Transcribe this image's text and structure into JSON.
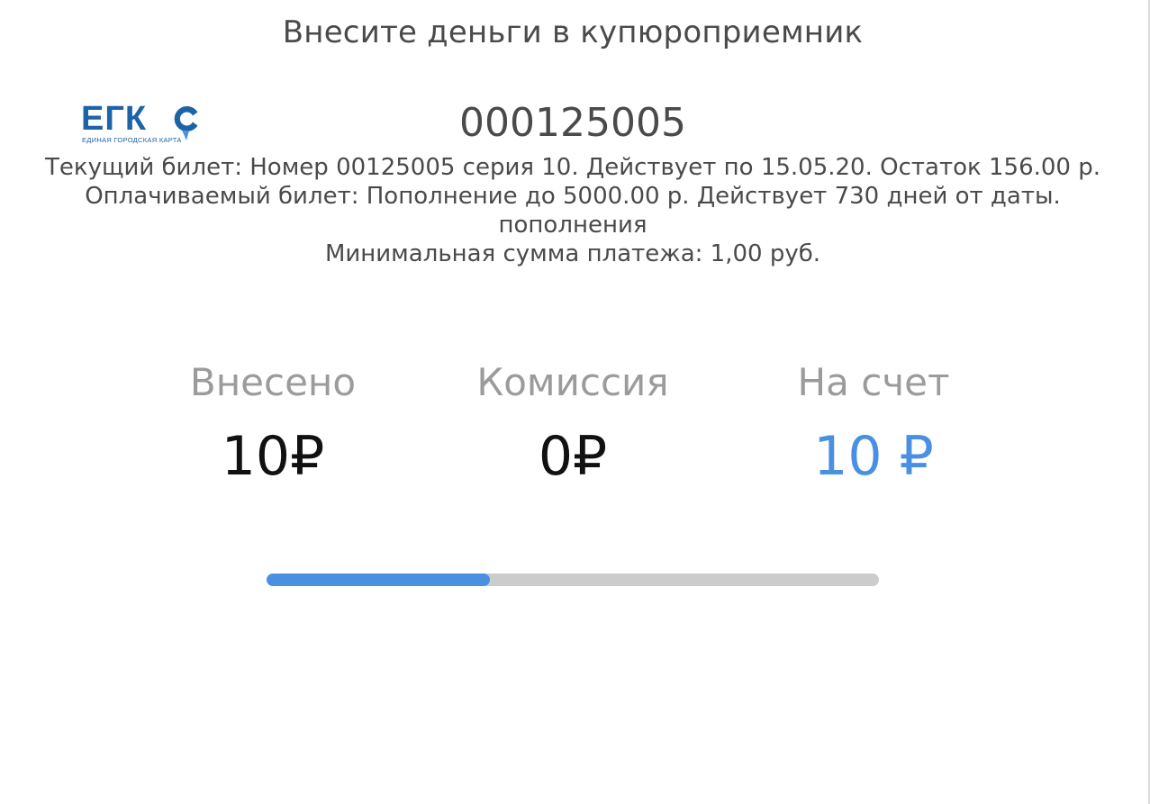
{
  "header": {
    "instruction": "Внесите деньги в купюроприемник"
  },
  "logo": {
    "letters": "ЕГК",
    "subtitle": "ЕДИНАЯ ГОРОДСКАЯ КАРТА",
    "icon": "location-pin-c-icon",
    "color": "#1d63a8"
  },
  "card": {
    "number": "000125005"
  },
  "ticket": {
    "current": "Текущий билет: Номер 00125005 серия 10. Действует по 15.05.20. Остаток 156.00 р.",
    "paid_line1": "Оплачиваемый билет: Пополнение до 5000.00 р. Действует 730 дней от даты.",
    "paid_line2": "пополнения",
    "min_payment": "Минимальная сумма платежа: 1,00 руб."
  },
  "summary": {
    "deposited": {
      "label": "Внесено",
      "value": "10₽"
    },
    "commission": {
      "label": "Комиссия",
      "value": "0₽"
    },
    "to_account": {
      "label": "На счет",
      "value": "10 ₽"
    }
  },
  "progress": {
    "fraction": 0.365,
    "fill_color": "#4a90e2",
    "track_color": "#cccccc"
  },
  "colors": {
    "accent": "#4a90e2",
    "text": "#4a4a4a",
    "muted": "#9b9b9b"
  }
}
